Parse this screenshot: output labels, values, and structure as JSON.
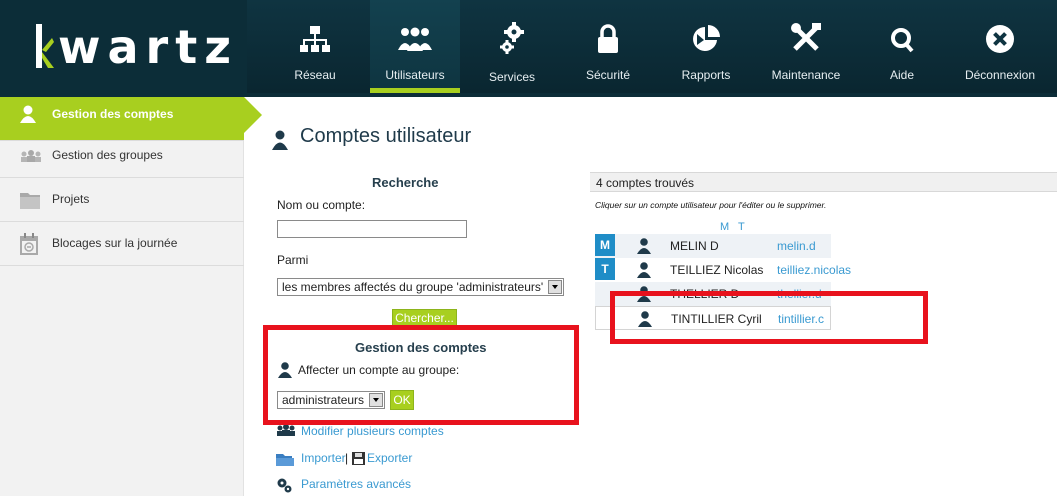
{
  "app": {
    "logo_text": "kwartz",
    "accent_color": "#a8cf1f",
    "primary_color": "#0f3441"
  },
  "nav": [
    {
      "label": "Réseau",
      "icon": "network-icon"
    },
    {
      "label": "Utilisateurs",
      "icon": "users-icon",
      "active": true
    },
    {
      "label": "Services",
      "icon": "gears-icon"
    },
    {
      "label": "Sécurité",
      "icon": "lock-icon"
    },
    {
      "label": "Rapports",
      "icon": "pie-chart-icon"
    },
    {
      "label": "Maintenance",
      "icon": "tools-icon"
    },
    {
      "label": "Aide",
      "icon": "search-icon"
    },
    {
      "label": "Déconnexion",
      "icon": "close-circle-icon"
    }
  ],
  "sidebar": {
    "items": [
      {
        "label": "Gestion des comptes",
        "icon": "user-icon",
        "active": true
      },
      {
        "label": "Gestion des groupes",
        "icon": "group-icon"
      },
      {
        "label": "Projets",
        "icon": "folder-icon"
      },
      {
        "label": "Blocages sur la journée",
        "icon": "calendar-icon"
      }
    ]
  },
  "main": {
    "title": "Comptes utilisateur",
    "search": {
      "title": "Recherche",
      "name_label": "Nom ou compte:",
      "name_value": "",
      "among_label": "Parmi",
      "among_value": "les membres affectés du groupe 'administrateurs'",
      "search_button": "Chercher..."
    },
    "accounts": {
      "title": "Gestion des comptes",
      "assign_label": "Affecter un compte au groupe:",
      "group_value": "administrateurs",
      "ok_button": "OK",
      "modify_link": "Modifier plusieurs comptes",
      "import_link": "Importer",
      "export_link": "Exporter",
      "advanced_link": "Paramètres avancés"
    }
  },
  "results": {
    "count_text": "4 comptes trouvés",
    "hint": "Cliquer sur un compte utilisateur pour l'éditer ou le supprimer.",
    "letters": "M T",
    "rows": [
      {
        "letter": "M",
        "name": "MELIN D",
        "login": "melin.d"
      },
      {
        "letter": "T",
        "name": "TEILLIEZ Nicolas",
        "login": "teilliez.nicolas"
      },
      {
        "letter": "",
        "name": "THELLIER D",
        "login": "thellier.d"
      },
      {
        "letter": "",
        "name": "TINTILLIER Cyril",
        "login": "tintillier.c"
      }
    ]
  }
}
